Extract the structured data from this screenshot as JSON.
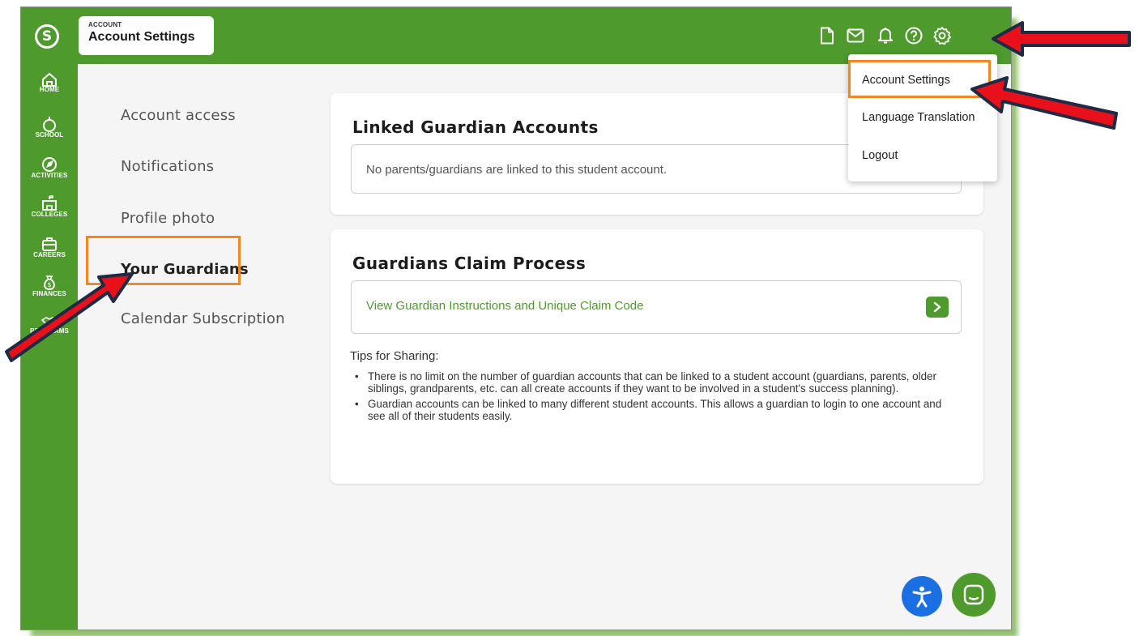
{
  "header": {
    "breadcrumb_small": "ACCOUNT",
    "breadcrumb_title": "Account Settings",
    "icons": [
      "document-icon",
      "mail-icon",
      "bell-icon",
      "help-icon",
      "gear-icon"
    ]
  },
  "rail": {
    "items": [
      {
        "label": "HOME",
        "icon": "home-icon"
      },
      {
        "label": "SCHOOL",
        "icon": "apple-icon"
      },
      {
        "label": "ACTIVITIES",
        "icon": "compass-icon"
      },
      {
        "label": "COLLEGES",
        "icon": "college-icon"
      },
      {
        "label": "CAREERS",
        "icon": "briefcase-icon"
      },
      {
        "label": "FINANCES",
        "icon": "money-bag-icon"
      },
      {
        "label": "PROGRAMS",
        "icon": "handshake-icon"
      }
    ]
  },
  "settings_nav": {
    "items": [
      {
        "label": "Account access"
      },
      {
        "label": "Notifications"
      },
      {
        "label": "Profile photo"
      },
      {
        "label": "Your Guardians",
        "active": true
      },
      {
        "label": "Calendar Subscription"
      }
    ]
  },
  "linked_card": {
    "title": "Linked Guardian Accounts",
    "empty_message": "No parents/guardians are linked to this student account."
  },
  "claim_card": {
    "title": "Guardians Claim Process",
    "link_label": "View Guardian Instructions and Unique Claim Code",
    "tips_title": "Tips for Sharing:",
    "tips": [
      "There is no limit on the number of guardian accounts that can be linked to a student account (guardians, parents, older siblings, grandparents, etc. can all create accounts if they want to be involved in a student's success planning).",
      "Guardian accounts can be linked to many different student accounts. This allows a guardian to login to one account and see all of their students easily."
    ]
  },
  "dropdown": {
    "items": [
      "Account Settings",
      "Language Translation",
      "Logout"
    ]
  },
  "colors": {
    "brand_green": "#4e9a2d",
    "highlight_orange": "#f5871f",
    "annotation_red": "#e8101a",
    "accessibility_blue": "#1a6fe3"
  }
}
